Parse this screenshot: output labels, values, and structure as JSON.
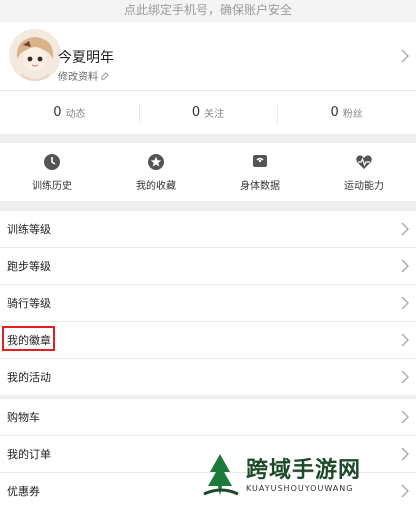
{
  "banner": {
    "text": "点此绑定手机号，确保账户安全"
  },
  "profile": {
    "name": "今夏明年",
    "edit_label": "修改资料"
  },
  "stats": [
    {
      "value": "0",
      "label": "动态"
    },
    {
      "value": "0",
      "label": "关注"
    },
    {
      "value": "0",
      "label": "粉丝"
    }
  ],
  "quick_actions": [
    {
      "label": "训练历史",
      "icon": "clock-icon"
    },
    {
      "label": "我的收藏",
      "icon": "star-icon"
    },
    {
      "label": "身体数据",
      "icon": "body-data-icon"
    },
    {
      "label": "运动能力",
      "icon": "heart-pulse-icon"
    }
  ],
  "menu_group_1": [
    {
      "label": "训练等级"
    },
    {
      "label": "跑步等级"
    },
    {
      "label": "骑行等级"
    },
    {
      "label": "我的徽章",
      "highlighted": true
    },
    {
      "label": "我的活动"
    }
  ],
  "menu_group_2": [
    {
      "label": "购物车"
    },
    {
      "label": "我的订单"
    },
    {
      "label": "优惠券"
    }
  ],
  "watermark": {
    "title": "跨域手游网",
    "subtitle": "KUAYUSHOUYOUWANG"
  },
  "colors": {
    "highlight_border": "#e51f1f",
    "background": "#eeeeee"
  }
}
